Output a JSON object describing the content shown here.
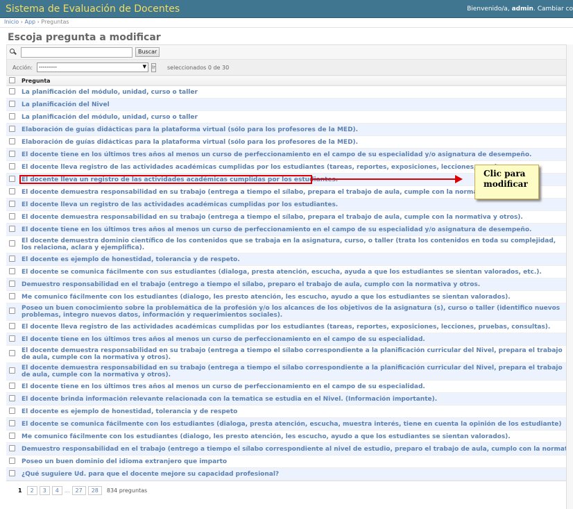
{
  "header": {
    "app_title": "Sistema de Evaluación de Docentes",
    "welcome": "Bienvenido/a,",
    "username": "admin",
    "change": "Cambiar co"
  },
  "breadcrumb": {
    "home": "Inicio",
    "sep1": "›",
    "app": "App",
    "sep2": "›",
    "current": "Preguntas"
  },
  "page_title": "Escoja pregunta a modificar",
  "search": {
    "value": "",
    "button_label": "Buscar"
  },
  "actions": {
    "label": "Acción:",
    "selected_value": "---------",
    "go_label": "Ir",
    "selected_count": "seleccionados 0 de 30"
  },
  "table": {
    "column_header": "Pregunta",
    "rows": [
      "La planificación del módulo, unidad, curso o taller",
      "La planificación del Nivel",
      "La planificación del módulo, unidad, curso o taller",
      "Elaboración de guías didácticas para la plataforma virtual (sólo para los profesores de la MED).",
      "Elaboración de guías didácticas para la plataforma virtual (sólo para los profesores de la MED).",
      "El docente tiene en los últimos tres años al menos un curso de perfeccionamiento en el campo de su especialidad y/o asignatura de desempeño.",
      "El docente lleva registro de las actividades académicas cumplidas por los estudiantes (tareas, reportes, exposiciones, lecciones, pruebas, con",
      "El docente lleva un registro de las actividades académicas cumplidas por los estudiantes.",
      "El docente demuestra responsabilidad en su trabajo (entrega a tiempo el sílabo, prepara el trabajo de aula, cumple con la normativa y otros).",
      "El docente lleva un registro de las actividades académicas cumplidas por los estudiantes.",
      "El docente demuestra responsabilidad en su trabajo (entrega a tiempo el sílabo, prepara el trabajo de aula, cumple con la normativa y otros).",
      "El docente tiene en los últimos tres años al menos un curso de perfeccionamiento en el campo de su especialidad y/o asignatura de desempeño.",
      "El docente demuestra dominio científico de los contenidos que se trabaja en la asignatura, curso,  o taller  (trata los contenidos en toda su complejidad, los relaciona, aclara y ejemplifica).",
      "El docente es ejemplo de honestidad, tolerancia y de respeto.",
      "El docente se comunica fácilmente  con sus estudiantes (dialoga, presta atención, escucha, ayuda a que los estudiantes se sientan valorados, etc.).",
      "Demuestro responsabilidad en el trabajo (entrego a tiempo el sílabo, preparo el trabajo de aula, cumplo con la normativa y otros.",
      "Me comunico fácilmente con los estudiantes (dialogo, les presto atención, les escucho, ayudo a que los estudiantes se sientan valorados).",
      "Poseo un buen conocimiento sobre la problemática de la profesión  y/o los alcances de los objetivos de la asignatura (s), curso o taller (identifico nuevos problemas, integro nuevos datos, información y requerimientos sociales).",
      "El docente lleva registro de las actividades académicas cumplidas por los estudiantes (tareas, reportes, exposiciones, lecciones, pruebas, consultas).",
      "El docente tiene en los últimos tres años al menos un curso de perfeccionamiento en el campo de su especialidad.",
      "El docente demuestra responsabilidad en su trabajo (entrega a tiempo el sílabo correspondiente a la planificación curricular del Nivel, prepara el trabajo de aula, cumple con la normativa y otros).",
      "El docente demuestra responsabilidad en su trabajo (entrega a tiempo el sílabo correspondiente a la planificación curricular del Nivel, prepara el trabajo de aula, cumple con la normativa y otros).",
      "El docente tiene en los últimos tres años al menos un curso de perfeccionamiento en el campo de su especialidad.",
      "El docente brinda información relevante relacionada con la tematica se estudia en el Nivel. (Información importante).",
      "El docente es ejemplo de honestidad, tolerancia y de respeto",
      "El docente se comunica fácilmente con los estudiantes (dialoga, presta atención, escucha, muestra interés, tiene en cuenta la opinión de los estudiante)",
      "Me comunico fácilmente con los estudiantes (dialogo, les presto atención, les escucho, ayudo a que los estudiantes se sientan valorados).",
      "Demuestro responsabilidad en el trabajo (entrego a tiempo el sílabo correspondiente al nivel de estudio, preparo el trabajo de aula, cumplo con la normativa y otros).",
      "Poseo un buen dominio del idioma extranjero que imparto",
      "¿Qué suguiere Ud. para que el docente mejore su capacidad profesional?"
    ]
  },
  "pagination": {
    "current": "1",
    "p2": "2",
    "p3": "3",
    "p4": "4",
    "dots": "...",
    "p27": "27",
    "p28": "28",
    "total": "834 preguntas"
  },
  "annotation": {
    "line1": "Clic para",
    "line2": "modificar",
    "color": "#dd0000"
  }
}
